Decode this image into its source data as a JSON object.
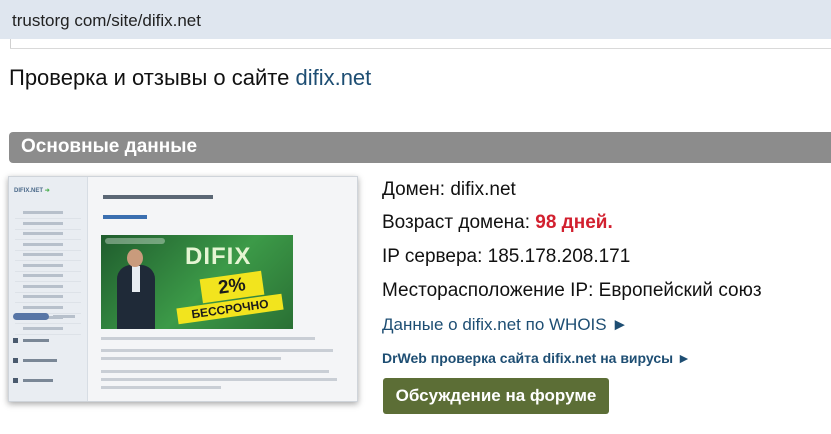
{
  "address_bar": {
    "url": "trustorg com/site/difix.net"
  },
  "page": {
    "title_prefix": "Проверка и отзывы о сайте ",
    "title_site": "difix.net"
  },
  "section": {
    "title": "Основные данные"
  },
  "thumbnail": {
    "logo": "DIFIX.NET",
    "banner_word": "DIFIX",
    "banner_percent": "2%",
    "banner_forever": "БЕССРОЧНО"
  },
  "info": {
    "domain_label": "Домен:",
    "domain_value": "difix.net",
    "age_label": "Возраст домена:",
    "age_value": "98 дней.",
    "ip_label": "IP сервера:",
    "ip_value": "185.178.208.171",
    "location_label": "Месторасположение IP:",
    "location_value": "Европейский союз"
  },
  "links": {
    "whois": "Данные о difix.net по WHOIS ►",
    "drweb": "DrWeb проверка сайта difix.net на вирусы ►"
  },
  "buttons": {
    "forum": "Обсуждение на форуме"
  },
  "colors": {
    "section_bg": "#8c8c8c",
    "link": "#1e4e73",
    "age_red": "#d2202f",
    "forum_button": "#5c6e36",
    "address_bar_bg": "#dfe6ef"
  }
}
